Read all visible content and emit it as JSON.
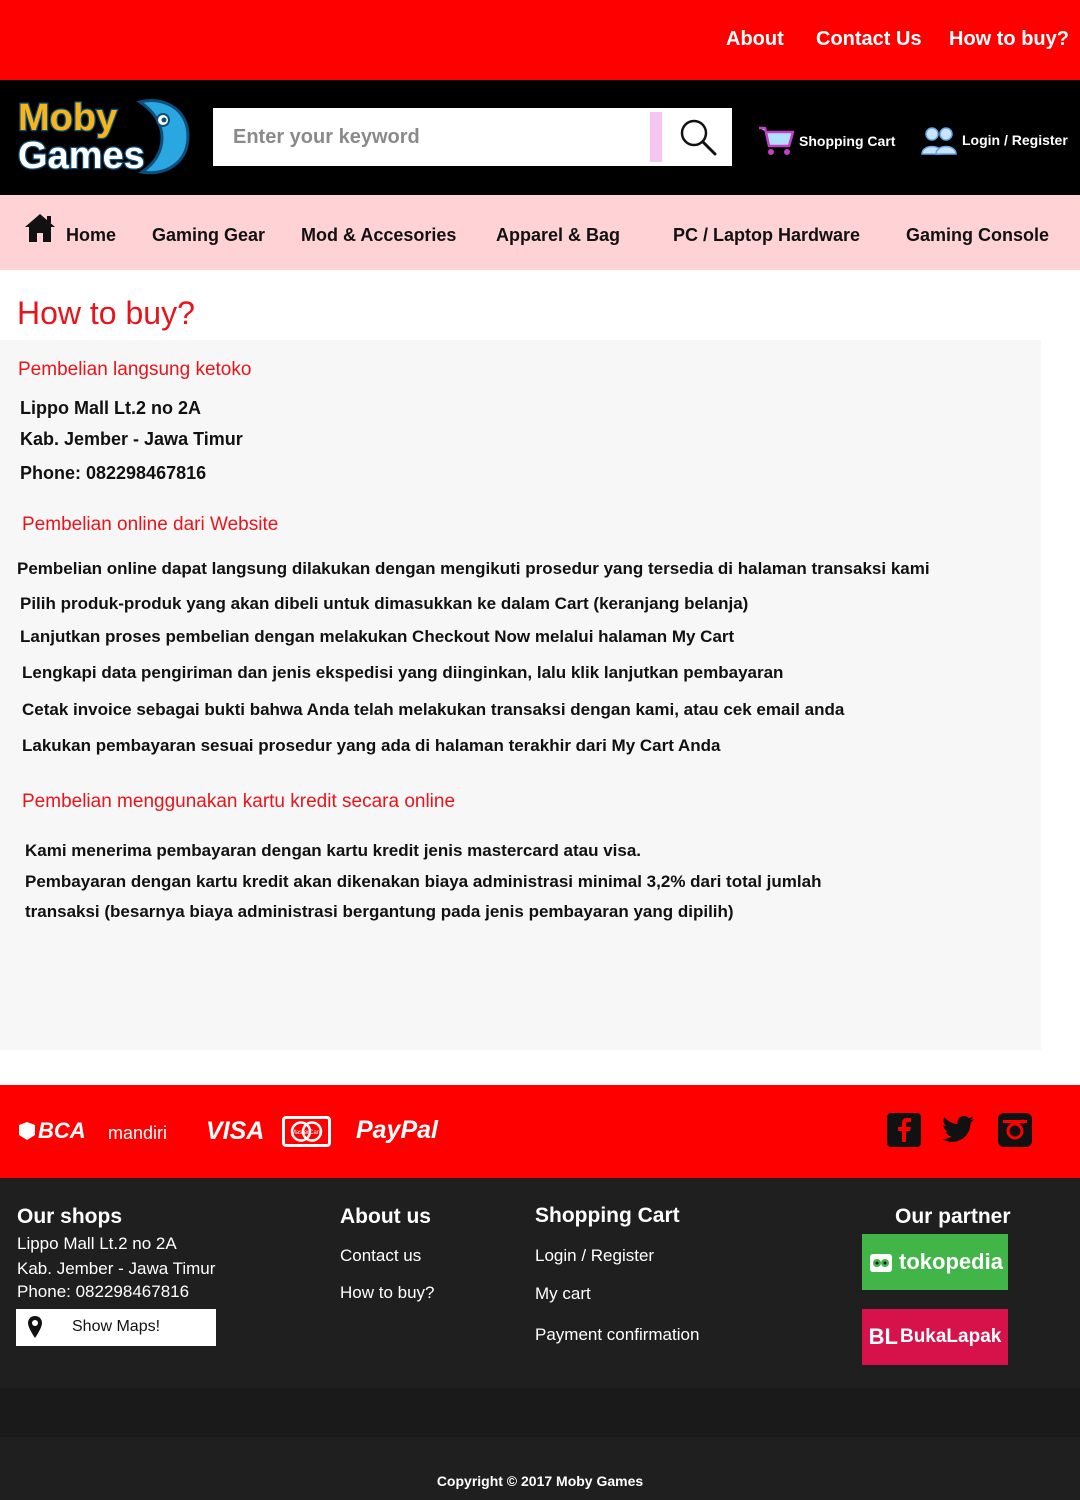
{
  "topbar": {
    "links": [
      "About",
      "Contact Us",
      "How to buy?"
    ]
  },
  "header": {
    "logo_line1": "Moby",
    "logo_line2": "Games",
    "search_placeholder": "Enter your keyword",
    "cart_label": "Shopping Cart",
    "login_label": "Login / Register"
  },
  "nav": {
    "items": [
      "Home",
      "Gaming Gear",
      "Mod & Accesories",
      "Apparel & Bag",
      "PC / Laptop Hardware",
      "Gaming Console"
    ]
  },
  "page": {
    "title": "How to buy?",
    "sections": [
      {
        "heading": "Pembelian langsung ketoko",
        "lines": [
          "Lippo Mall Lt.2 no 2A",
          "Kab. Jember - Jawa Timur",
          "Phone: 082298467816"
        ]
      },
      {
        "heading": "Pembelian online dari Website",
        "lines": [
          "Pembelian online dapat langsung dilakukan dengan mengikuti prosedur yang tersedia di halaman transaksi kami",
          "Pilih produk-produk yang akan dibeli untuk dimasukkan ke dalam Cart (keranjang belanja)",
          "Lanjutkan proses pembelian dengan melakukan Checkout Now melalui halaman My Cart",
          "Lengkapi data pengiriman dan jenis ekspedisi yang diinginkan, lalu klik lanjutkan pembayaran",
          "Cetak invoice sebagai bukti bahwa Anda telah melakukan transaksi dengan kami, atau cek email anda",
          "Lakukan pembayaran sesuai prosedur yang ada di halaman terakhir dari My Cart Anda"
        ]
      },
      {
        "heading": "Pembelian menggunakan kartu kredit secara online",
        "lines": [
          "Kami menerima pembayaran dengan kartu kredit jenis mastercard atau visa.",
          "Pembayaran dengan kartu kredit akan dikenakan biaya administrasi minimal 3,2% dari total jumlah",
          "transaksi (besarnya biaya administrasi bergantung pada jenis pembayaran yang dipilih)"
        ]
      }
    ]
  },
  "payments": {
    "methods": [
      "BCA",
      "mandiri",
      "VISA",
      "MasterCard",
      "PayPal"
    ],
    "social": [
      "facebook-icon",
      "twitter-icon",
      "instagram-icon"
    ]
  },
  "footer": {
    "shops": {
      "heading": "Our shops",
      "lines": [
        "Lippo Mall Lt.2 no 2A",
        "Kab. Jember - Jawa Timur",
        "Phone: 082298467816"
      ],
      "maps_button": "Show Maps!"
    },
    "about": {
      "heading": "About us",
      "links": [
        "Contact us",
        "How to buy?"
      ]
    },
    "cart": {
      "heading": "Shopping Cart",
      "links": [
        "Login / Register",
        "My cart",
        "Payment confirmation"
      ]
    },
    "partner": {
      "heading": "Our partner",
      "partners": [
        "tokopedia",
        "BL",
        "BukaLapak"
      ]
    },
    "copyright": "Copyright © 2017 Moby Games"
  },
  "colors": {
    "brand_red": "#ff0000",
    "heading_red": "#e8141c",
    "nav_pink": "#ffd3d5",
    "header_black": "#000000",
    "footer_dark": "#1f1f1f",
    "tokopedia_green": "#42b549",
    "bukalapak_pink": "#d71149"
  }
}
